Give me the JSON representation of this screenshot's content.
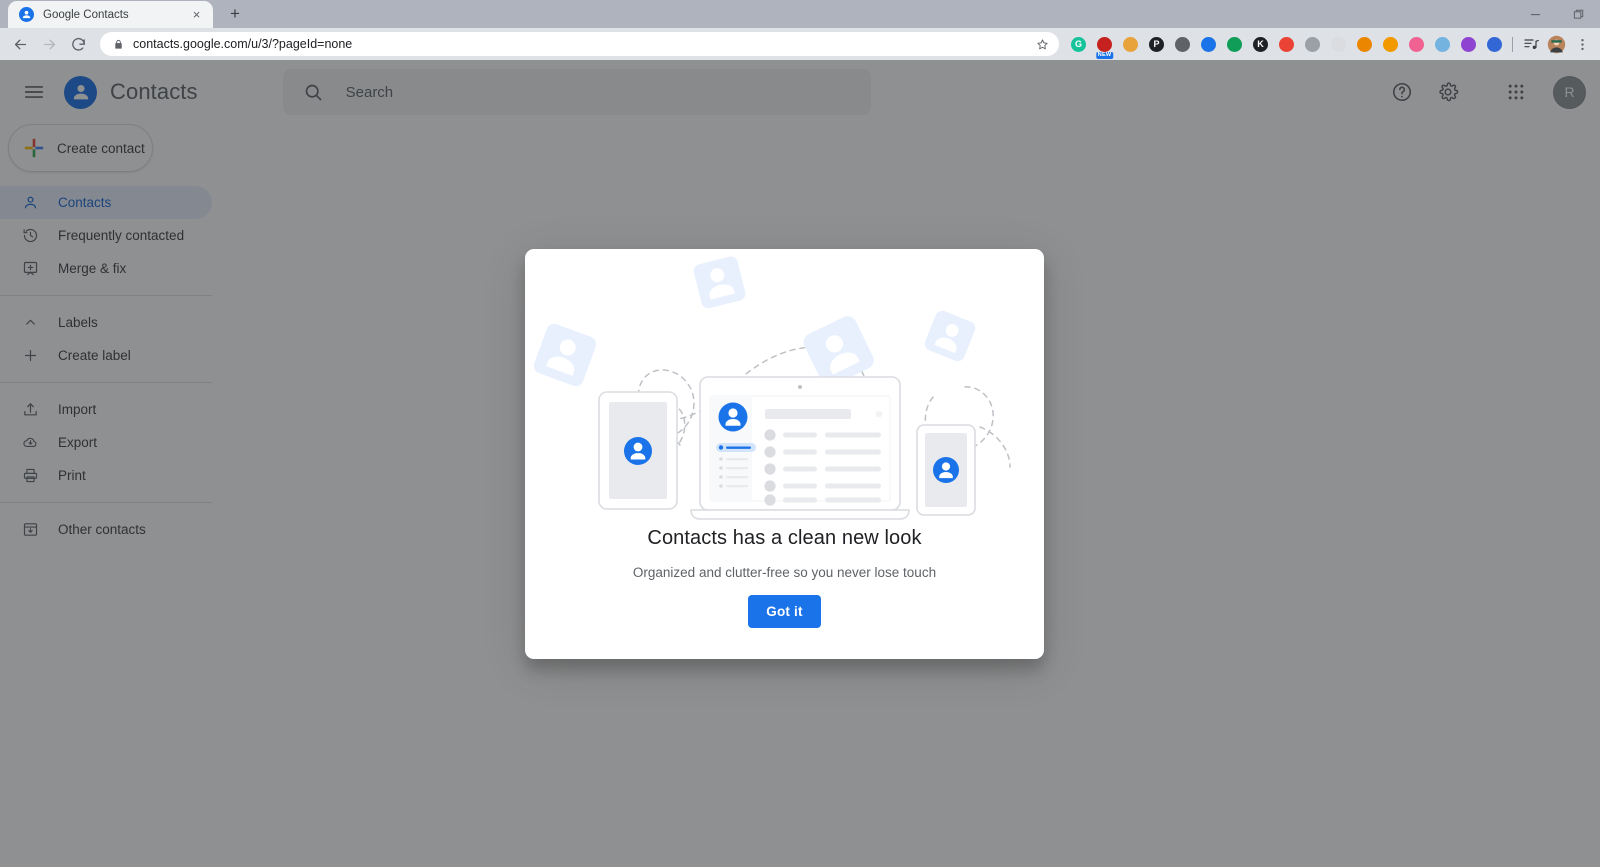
{
  "browser": {
    "tab": {
      "title": "Google Contacts",
      "favicon": "contacts-favicon",
      "close": "×"
    },
    "new_tab": "+",
    "window_controls": {
      "minimize": "minimize-icon",
      "maximize": "maximize-icon"
    },
    "nav": {
      "back": "back-arrow-icon",
      "forward": "forward-arrow-icon",
      "reload": "reload-icon"
    },
    "omnibox": {
      "url": "contacts.google.com/u/3/?pageId=none",
      "lock": "lock-icon",
      "star": "star-icon"
    },
    "extensions": [
      {
        "name": "grammarly-extension",
        "glyph": "G",
        "bg": "#15c39a",
        "fg": "#ffffff",
        "badge": ""
      },
      {
        "name": "screenshot-extension",
        "glyph": "",
        "bg": "#c5221f",
        "fg": "#ffffff",
        "badge": "NEW"
      },
      {
        "name": "cookie-extension",
        "glyph": "",
        "bg": "#e8a33d",
        "fg": "#ffffff",
        "badge": ""
      },
      {
        "name": "pocket-extension",
        "glyph": "P",
        "bg": "#202124",
        "fg": "#ffffff",
        "badge": ""
      },
      {
        "name": "microscope-extension",
        "glyph": "",
        "bg": "#5f6368",
        "fg": "#ffffff",
        "badge": ""
      },
      {
        "name": "adblock-extension",
        "glyph": "",
        "bg": "#1a73e8",
        "fg": "#ffffff",
        "badge": ""
      },
      {
        "name": "globe-extension",
        "glyph": "",
        "bg": "#0f9d58",
        "fg": "#ffffff",
        "badge": ""
      },
      {
        "name": "kaspersky-extension",
        "glyph": "K",
        "bg": "#202124",
        "fg": "#ffffff",
        "badge": ""
      },
      {
        "name": "shield-extension",
        "glyph": "",
        "bg": "#ea4335",
        "fg": "#ffffff",
        "badge": ""
      },
      {
        "name": "rocket-extension",
        "glyph": "",
        "bg": "#9aa0a6",
        "fg": "#ffffff",
        "badge": ""
      },
      {
        "name": "swirl-extension",
        "glyph": "",
        "bg": "#dadce0",
        "fg": "#ffffff",
        "badge": ""
      },
      {
        "name": "flame-extension",
        "glyph": "",
        "bg": "#ea8600",
        "fg": "#ffffff",
        "badge": ""
      },
      {
        "name": "capsule-extension",
        "glyph": "",
        "bg": "#f29900",
        "fg": "#ffffff",
        "badge": ""
      },
      {
        "name": "spiral-extension",
        "glyph": "",
        "bg": "#f06292",
        "fg": "#ffffff",
        "badge": ""
      },
      {
        "name": "cloud-extension",
        "glyph": "",
        "bg": "#74b3e0",
        "fg": "#ffffff",
        "badge": ""
      },
      {
        "name": "media-extension",
        "glyph": "",
        "bg": "#8e44d0",
        "fg": "#ffffff",
        "badge": ""
      },
      {
        "name": "download-extension",
        "glyph": "",
        "bg": "#3367d6",
        "fg": "#ffffff",
        "badge": ""
      }
    ],
    "reading_list": "reading-list-icon",
    "profile": "profile-avatar",
    "menu": "chrome-menu-icon"
  },
  "app": {
    "menu_button": "hamburger-menu-icon",
    "brand": {
      "logo": "contacts-logo",
      "name": "Contacts"
    },
    "search": {
      "icon": "search-icon",
      "placeholder": "Search"
    },
    "actions": {
      "help": "help-icon",
      "settings": "gear-icon",
      "apps": "apps-grid-icon",
      "avatar_letter": "R"
    },
    "create_contact": {
      "label": "Create contact",
      "icon": "plus-icon"
    },
    "nav": [
      {
        "label": "Contacts",
        "icon": "person-icon",
        "active": true
      },
      {
        "label": "Frequently contacted",
        "icon": "history-icon",
        "active": false
      },
      {
        "label": "Merge & fix",
        "icon": "merge-icon",
        "active": false
      }
    ],
    "labels_section": [
      {
        "label": "Labels",
        "icon": "chevron-up-icon",
        "active": false
      },
      {
        "label": "Create label",
        "icon": "plus-thin-icon",
        "active": false
      }
    ],
    "tools_section": [
      {
        "label": "Import",
        "icon": "import-icon",
        "active": false
      },
      {
        "label": "Export",
        "icon": "export-icon",
        "active": false
      },
      {
        "label": "Print",
        "icon": "printer-icon",
        "active": false
      }
    ],
    "other_section": [
      {
        "label": "Other contacts",
        "icon": "archive-icon",
        "active": false
      }
    ]
  },
  "dialog": {
    "title": "Contacts has a clean new look",
    "subtitle": "Organized and clutter-free so you never lose touch",
    "button": "Got it",
    "illustration": "devices-contacts-illustration"
  },
  "colors": {
    "accent": "#1a73e8",
    "active_nav_bg": "#e8f0fe",
    "active_nav_fg": "#1967d2",
    "illustration_card": "#e8f0fe",
    "device_screen": "#e8eaed",
    "scrim": "#202124"
  }
}
